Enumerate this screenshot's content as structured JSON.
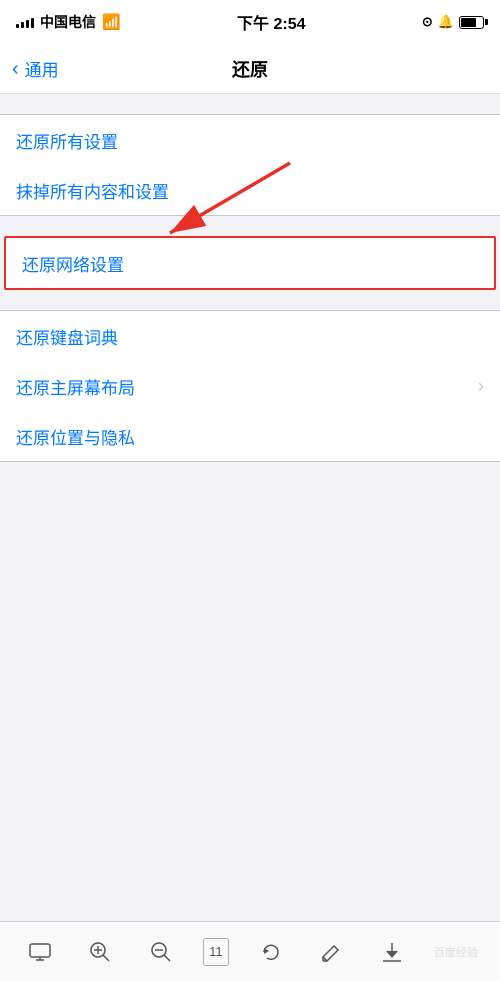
{
  "statusBar": {
    "carrier": "中国电信",
    "wifi": "WiFi",
    "time": "下午 2:54",
    "batteryLevel": 70
  },
  "navBar": {
    "backLabel": "通用",
    "title": "还原"
  },
  "sections": [
    {
      "id": "section1",
      "items": [
        {
          "id": "reset-all-settings",
          "label": "还原所有设置",
          "hasChevron": false
        },
        {
          "id": "erase-all-content",
          "label": "抹掉所有内容和设置",
          "hasChevron": false
        }
      ]
    },
    {
      "id": "section2-highlighted",
      "items": [
        {
          "id": "reset-network",
          "label": "还原网络设置",
          "hasChevron": false,
          "highlighted": true
        }
      ]
    },
    {
      "id": "section3",
      "items": [
        {
          "id": "reset-keyboard",
          "label": "还原键盘词典",
          "hasChevron": false
        },
        {
          "id": "reset-home-screen",
          "label": "还原主屏幕布局",
          "hasChevron": true
        },
        {
          "id": "reset-location",
          "label": "还原位置与隐私",
          "hasChevron": false
        }
      ]
    }
  ],
  "toolbar": {
    "buttons": [
      "⊞",
      "⊕",
      "⊖",
      "11",
      "↺",
      "✎",
      "⬇"
    ]
  }
}
